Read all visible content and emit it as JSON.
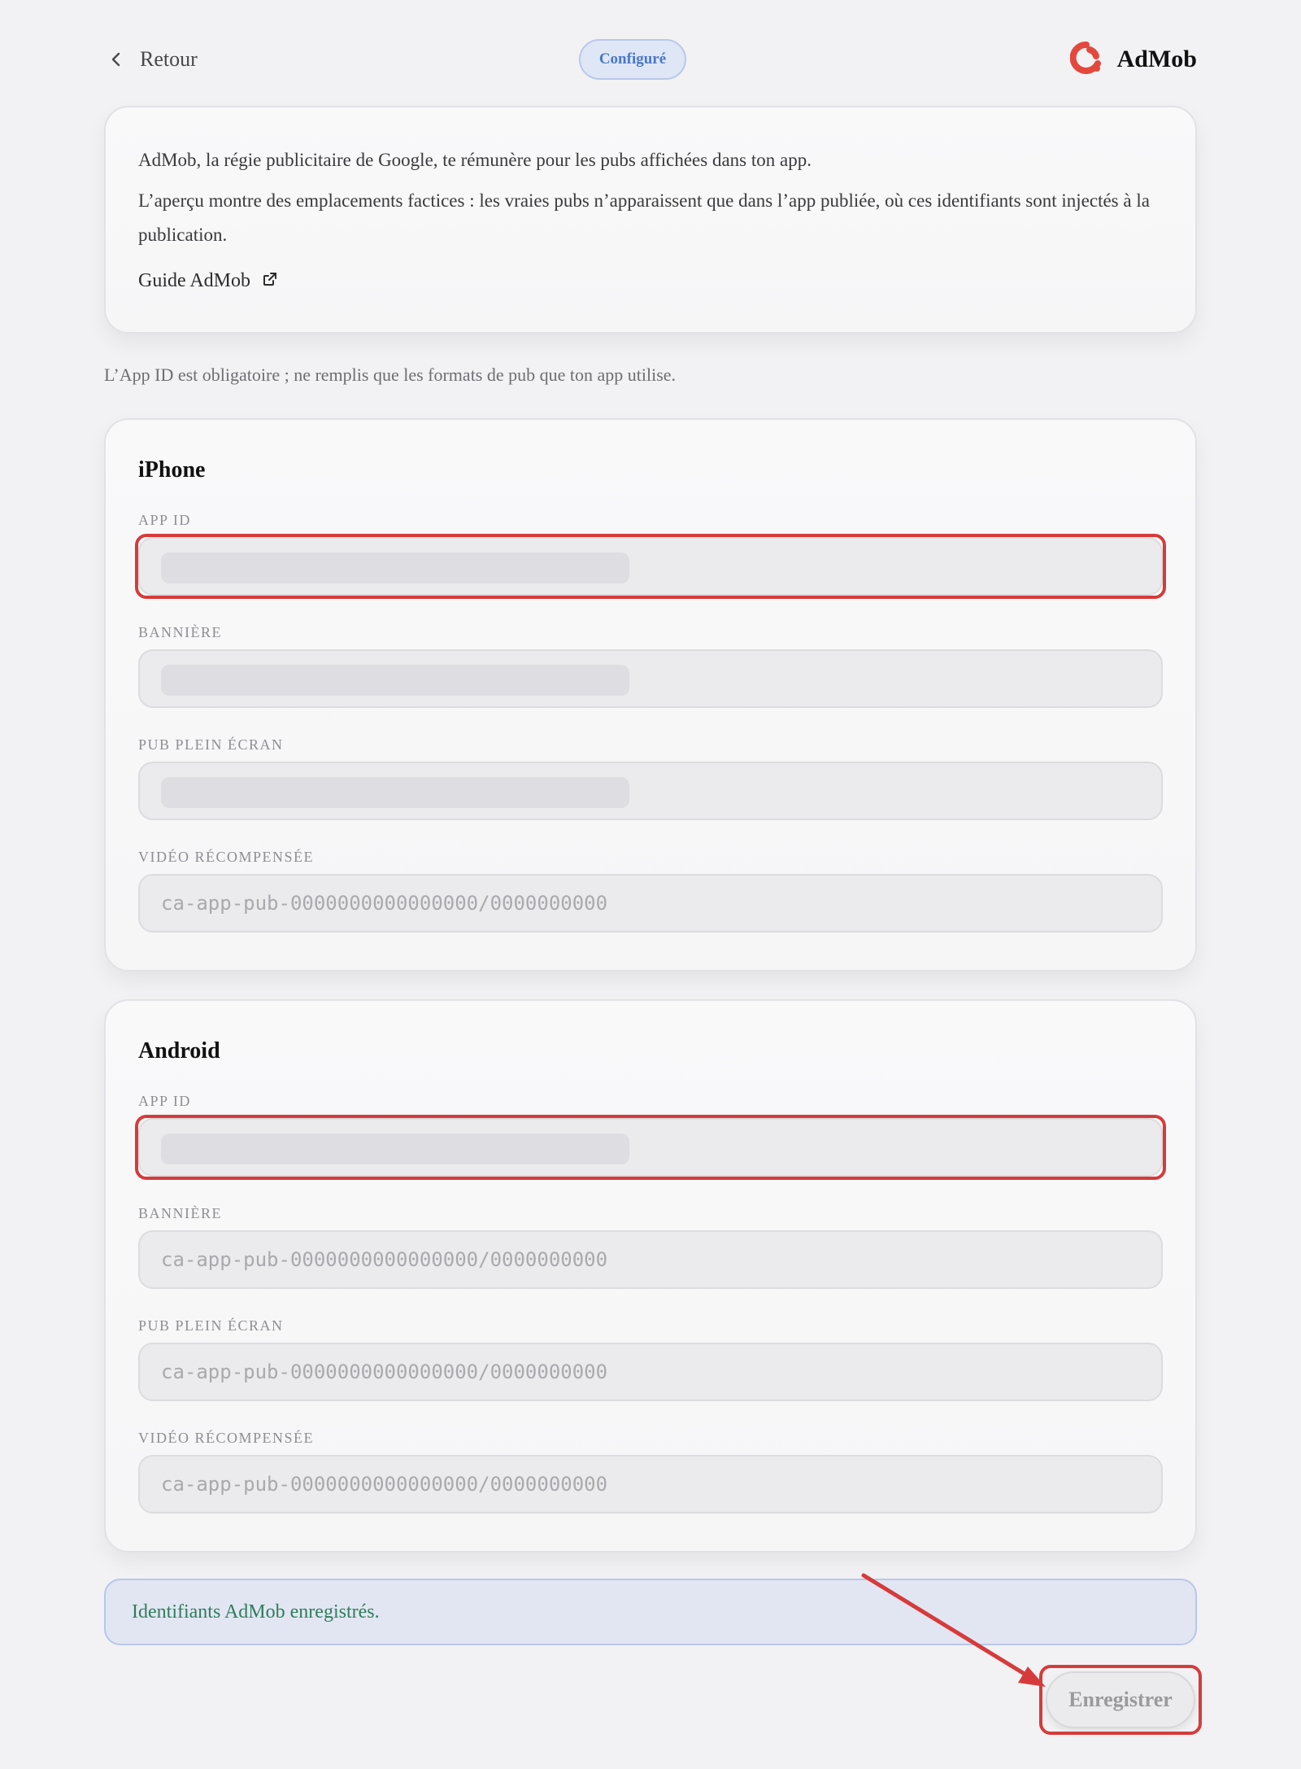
{
  "header": {
    "back_label": "Retour",
    "status_badge": "Configuré",
    "brand_name": "AdMob",
    "brand_color": "#e4483d"
  },
  "intro": {
    "p1": "AdMob, la régie publicitaire de Google, te rémunère pour les pubs affichées dans ton app.",
    "p2": "L’aperçu montre des emplacements factices : les vraies pubs n’apparaissent que dans l’app publiée, où ces identifiants sont injectés à la publication.",
    "guide_label": "Guide AdMob"
  },
  "hint": "L’App ID est obligatoire ; ne remplis que les formats de pub que ton app utilise.",
  "platforms": {
    "ios": {
      "title": "iPhone",
      "fields": [
        {
          "label": "APP ID",
          "value": "",
          "placeholder": "",
          "masked": true
        },
        {
          "label": "BANNIÈRE",
          "value": "",
          "placeholder": "",
          "masked": true
        },
        {
          "label": "PUB PLEIN ÉCRAN",
          "value": "",
          "placeholder": "",
          "masked": true
        },
        {
          "label": "VIDÉO RÉCOMPENSÉE",
          "value": "",
          "placeholder": "ca-app-pub-0000000000000000/0000000000",
          "masked": false
        }
      ]
    },
    "android": {
      "title": "Android",
      "fields": [
        {
          "label": "APP ID",
          "value": "",
          "placeholder": "",
          "masked": true
        },
        {
          "label": "BANNIÈRE",
          "value": "",
          "placeholder": "ca-app-pub-0000000000000000/0000000000",
          "masked": false
        },
        {
          "label": "PUB PLEIN ÉCRAN",
          "value": "",
          "placeholder": "ca-app-pub-0000000000000000/0000000000",
          "masked": false
        },
        {
          "label": "VIDÉO RÉCOMPENSÉE",
          "value": "",
          "placeholder": "ca-app-pub-0000000000000000/0000000000",
          "masked": false
        }
      ]
    }
  },
  "toast": "Identifiants AdMob enregistrés.",
  "save_label": "Enregistrer",
  "colors": {
    "highlight": "#d63b3b",
    "success_text": "#2e7d5b",
    "badge_text": "#4a78c8"
  }
}
